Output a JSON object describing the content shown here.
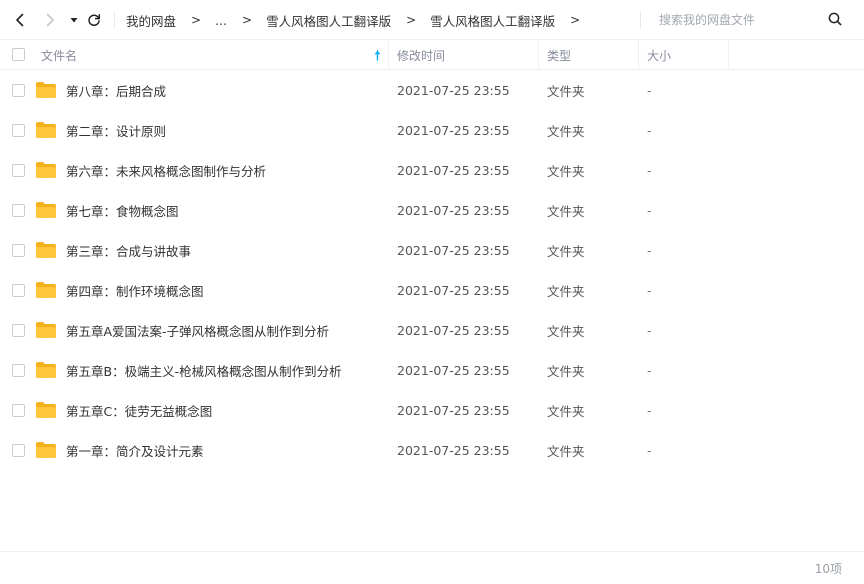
{
  "toolbar": {
    "back_icon": "chevron-left-icon",
    "forward_icon": "chevron-right-icon",
    "history_icon": "caret-down-icon",
    "refresh_icon": "refresh-icon"
  },
  "breadcrumb": [
    "我的网盘",
    "...",
    "雪人风格图人工翻译版",
    "雪人风格图人工翻译版"
  ],
  "breadcrumb_separator": ">",
  "search": {
    "placeholder": "搜索我的网盘文件",
    "icon": "search-icon"
  },
  "columns": {
    "name": "文件名",
    "mtime": "修改时间",
    "type": "类型",
    "size": "大小"
  },
  "sort": {
    "column": "name",
    "direction": "asc",
    "color": "#06a7ff"
  },
  "colors": {
    "folder": "#ffc53d",
    "folder_back": "#f5b21f",
    "border": "#eef0f3"
  },
  "files": [
    {
      "name": "第八章：后期合成",
      "mtime": "2021-07-25 23:55",
      "type": "文件夹",
      "size": "-"
    },
    {
      "name": "第二章：设计原则",
      "mtime": "2021-07-25 23:55",
      "type": "文件夹",
      "size": "-"
    },
    {
      "name": "第六章：未来风格概念图制作与分析",
      "mtime": "2021-07-25 23:55",
      "type": "文件夹",
      "size": "-"
    },
    {
      "name": "第七章：食物概念图",
      "mtime": "2021-07-25 23:55",
      "type": "文件夹",
      "size": "-"
    },
    {
      "name": "第三章：合成与讲故事",
      "mtime": "2021-07-25 23:55",
      "type": "文件夹",
      "size": "-"
    },
    {
      "name": "第四章：制作环境概念图",
      "mtime": "2021-07-25 23:55",
      "type": "文件夹",
      "size": "-"
    },
    {
      "name": "第五章A爱国法案-子弹风格概念图从制作到分析",
      "mtime": "2021-07-25 23:55",
      "type": "文件夹",
      "size": "-"
    },
    {
      "name": "第五章B：极端主义-枪械风格概念图从制作到分析",
      "mtime": "2021-07-25 23:55",
      "type": "文件夹",
      "size": "-"
    },
    {
      "name": "第五章C：徒劳无益概念图",
      "mtime": "2021-07-25 23:55",
      "type": "文件夹",
      "size": "-"
    },
    {
      "name": "第一章：简介及设计元素",
      "mtime": "2021-07-25 23:55",
      "type": "文件夹",
      "size": "-"
    }
  ],
  "footer": {
    "count": "10项"
  }
}
